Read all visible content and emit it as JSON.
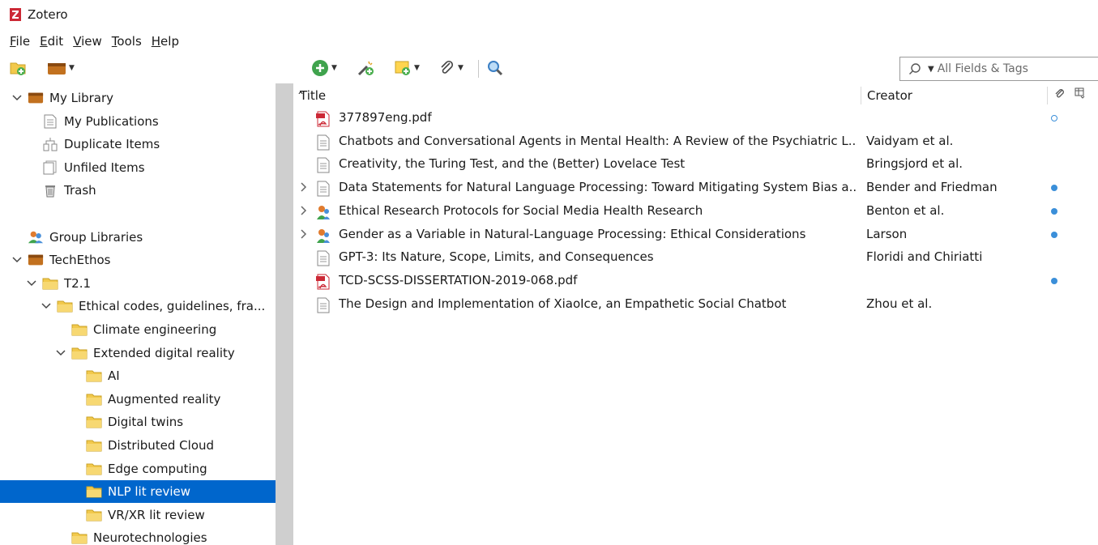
{
  "window": {
    "title": "Zotero"
  },
  "menu": [
    "File",
    "Edit",
    "View",
    "Tools",
    "Help"
  ],
  "menu_underline": [
    "F",
    "E",
    "V",
    "T",
    "H"
  ],
  "search": {
    "mode_label": "All Fields & Tags"
  },
  "tree": [
    {
      "label": "My Library",
      "icon": "library-icon",
      "twisty": "down",
      "level": 0
    },
    {
      "label": "My Publications",
      "icon": "document-icon",
      "twisty": "",
      "level": 1
    },
    {
      "label": "Duplicate Items",
      "icon": "duplicate-icon",
      "twisty": "",
      "level": 1
    },
    {
      "label": "Unfiled Items",
      "icon": "unfiled-icon",
      "twisty": "",
      "level": 1
    },
    {
      "label": "Trash",
      "icon": "trash-icon",
      "twisty": "",
      "level": 1
    },
    {
      "label": "",
      "icon": "",
      "twisty": "",
      "level": 0
    },
    {
      "label": "Group Libraries",
      "icon": "group-icon",
      "twisty": "",
      "level": 0
    },
    {
      "label": "TechEthos",
      "icon": "library-icon",
      "twisty": "down",
      "level": 0
    },
    {
      "label": "T2.1",
      "icon": "folder-icon",
      "twisty": "down",
      "level": 1
    },
    {
      "label": "Ethical codes, guidelines, fra...",
      "icon": "folder-icon",
      "twisty": "down",
      "level": 2
    },
    {
      "label": "Climate engineering",
      "icon": "folder-icon",
      "twisty": "",
      "level": 3
    },
    {
      "label": "Extended digital reality",
      "icon": "folder-icon",
      "twisty": "down",
      "level": 3
    },
    {
      "label": "AI",
      "icon": "folder-icon",
      "twisty": "",
      "level": 4
    },
    {
      "label": "Augmented reality",
      "icon": "folder-icon",
      "twisty": "",
      "level": 4
    },
    {
      "label": "Digital twins",
      "icon": "folder-icon",
      "twisty": "",
      "level": 4
    },
    {
      "label": "Distributed Cloud",
      "icon": "folder-icon",
      "twisty": "",
      "level": 4
    },
    {
      "label": "Edge computing",
      "icon": "folder-icon",
      "twisty": "",
      "level": 4
    },
    {
      "label": "NLP lit review",
      "icon": "folder-icon",
      "twisty": "",
      "level": 4,
      "selected": true
    },
    {
      "label": "VR/XR lit review",
      "icon": "folder-icon",
      "twisty": "",
      "level": 4
    },
    {
      "label": "Neurotechnologies",
      "icon": "folder-icon",
      "twisty": "",
      "level": 3
    }
  ],
  "columns": {
    "title": "Title",
    "creator": "Creator"
  },
  "items": [
    {
      "title": "377897eng.pdf",
      "creator": "",
      "icon": "pdf-icon",
      "twisty": false,
      "attachment": "outline"
    },
    {
      "title": "Chatbots and Conversational Agents in Mental Health: A Review of the Psychiatric L...",
      "creator": "Vaidyam et al.",
      "icon": "article-icon",
      "twisty": false,
      "attachment": ""
    },
    {
      "title": "Creativity, the Turing Test, and the (Better) Lovelace Test",
      "creator": "Bringsjord et al.",
      "icon": "article-icon",
      "twisty": false,
      "attachment": ""
    },
    {
      "title": "Data Statements for Natural Language Processing: Toward Mitigating System Bias a...",
      "creator": "Bender and Friedman",
      "icon": "article-icon",
      "twisty": true,
      "attachment": "filled"
    },
    {
      "title": "Ethical Research Protocols for Social Media Health Research",
      "creator": "Benton et al.",
      "icon": "conference-icon",
      "twisty": true,
      "attachment": "filled"
    },
    {
      "title": "Gender as a Variable in Natural-Language Processing: Ethical Considerations",
      "creator": "Larson",
      "icon": "conference-icon",
      "twisty": true,
      "attachment": "filled"
    },
    {
      "title": "GPT-3: Its Nature, Scope, Limits, and Consequences",
      "creator": "Floridi and Chiriatti",
      "icon": "article-icon",
      "twisty": false,
      "attachment": ""
    },
    {
      "title": "TCD-SCSS-DISSERTATION-2019-068.pdf",
      "creator": "",
      "icon": "pdf-icon",
      "twisty": false,
      "attachment": "filled"
    },
    {
      "title": "The Design and Implementation of XiaoIce, an Empathetic Social Chatbot",
      "creator": "Zhou et al.",
      "icon": "article-icon",
      "twisty": false,
      "attachment": ""
    }
  ],
  "colors": {
    "selected": "#0066cc",
    "folder": "#f2c94c",
    "splitter": "#cfcfcf",
    "attachment": "#3b8fd9"
  }
}
